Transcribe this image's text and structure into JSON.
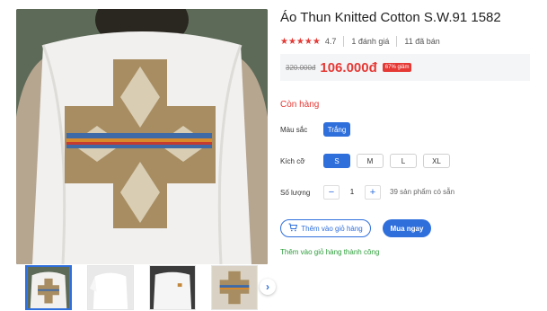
{
  "product": {
    "title": "Áo Thun Knitted Cotton S.W.91 1582",
    "rating": "4.7",
    "reviews": "1 đánh giá",
    "sold": "11 đã bán",
    "old_price": "320.000đ",
    "new_price": "106.000đ",
    "discount": "67% giảm",
    "stock_status": "Còn hàng"
  },
  "options": {
    "color_label": "Màu sắc",
    "colors": [
      "Trắng"
    ],
    "size_label": "Kích cỡ",
    "sizes": [
      "S",
      "M",
      "L",
      "XL"
    ],
    "qty_label": "Số lượng",
    "qty_value": "1",
    "qty_stock": "39 sản phẩm có sẵn"
  },
  "actions": {
    "add_to_cart": "Thêm vào giỏ hàng",
    "buy_now": "Mua ngay",
    "success_message": "Thêm vào giỏ hàng thành công"
  },
  "colors": {
    "accent": "#2f6fdc",
    "price_red": "#e53935",
    "success_green": "#2e9e3b"
  },
  "icons": [
    "star-icon",
    "cart-icon",
    "minus-icon",
    "plus-icon",
    "chevron-right-icon"
  ]
}
